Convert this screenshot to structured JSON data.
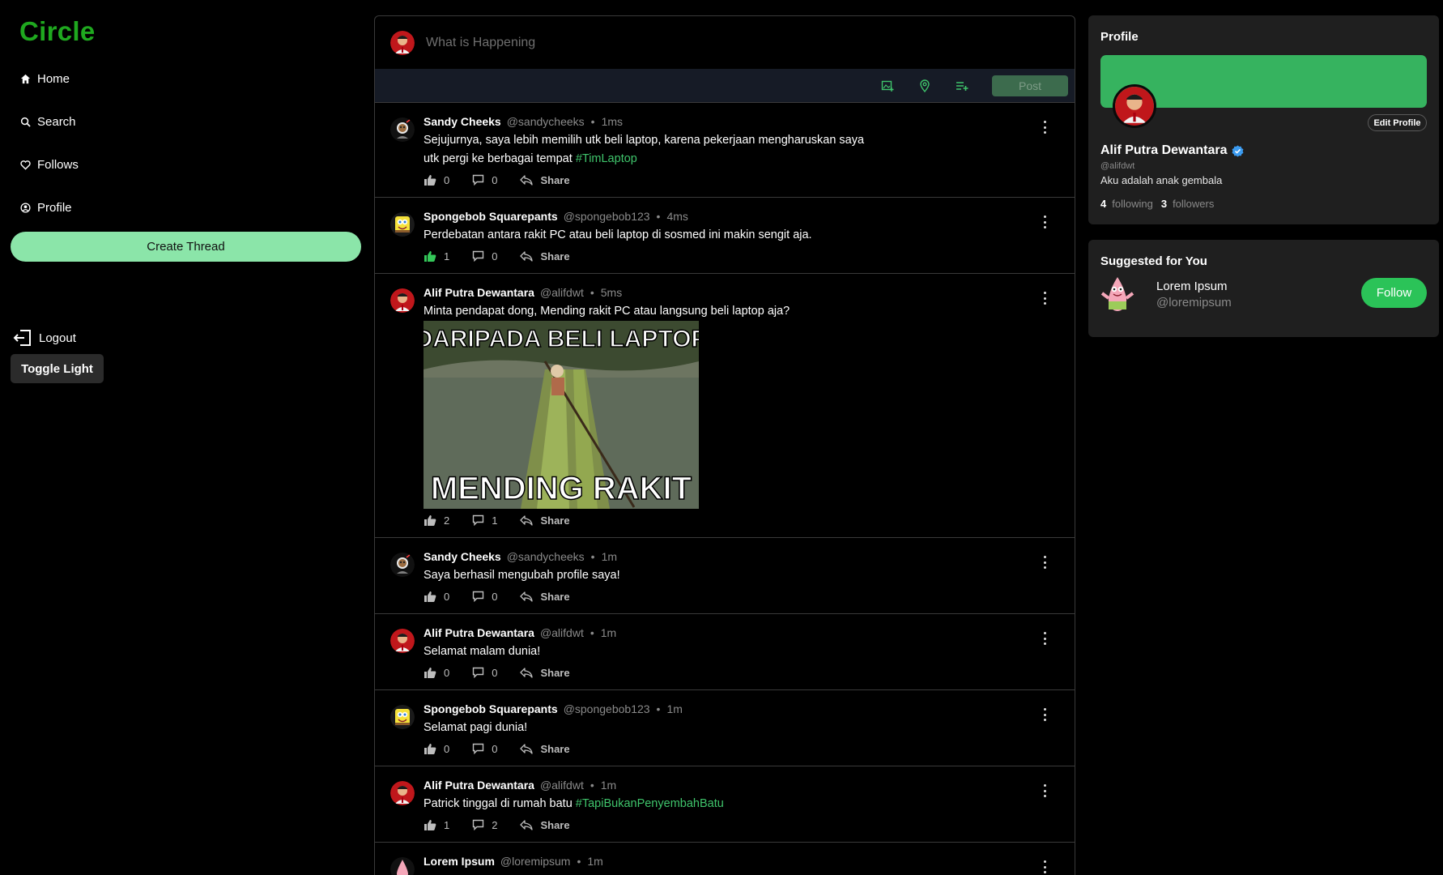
{
  "app": {
    "logo": "Circle"
  },
  "nav": {
    "home": "Home",
    "search": "Search",
    "follows": "Follows",
    "profile": "Profile",
    "create_thread": "Create Thread",
    "logout": "Logout",
    "toggle": "Toggle Light"
  },
  "composer": {
    "placeholder": "What is Happening",
    "post_label": "Post"
  },
  "threads": [
    {
      "name": "Sandy Cheeks",
      "handle": "@sandycheeks",
      "time": "1ms",
      "text": "Sejujurnya, saya lebih memilih utk beli laptop, karena pekerjaan mengharuskan saya utk pergi ke berbagai tempat ",
      "tag": "#TimLaptop",
      "likes": "0",
      "replies": "0",
      "share": "Share"
    },
    {
      "name": "Spongebob Squarepants",
      "handle": "@spongebob123",
      "time": "4ms",
      "text": "Perdebatan antara rakit PC atau beli laptop di sosmed ini makin sengit aja.",
      "likes": "1",
      "replies": "0",
      "share": "Share"
    },
    {
      "name": "Alif Putra Dewantara",
      "handle": "@alifdwt",
      "time": "5ms",
      "text": "Minta pendapat dong, Mending rakit PC atau langsung beli laptop aja?",
      "image_top": "DARIPADA BELI LAPTOP",
      "image_bottom": "MENDING RAKIT",
      "likes": "2",
      "replies": "1",
      "share": "Share"
    },
    {
      "name": "Sandy Cheeks",
      "handle": "@sandycheeks",
      "time": "1m",
      "text": "Saya berhasil mengubah profile saya!",
      "likes": "0",
      "replies": "0",
      "share": "Share"
    },
    {
      "name": "Alif Putra Dewantara",
      "handle": "@alifdwt",
      "time": "1m",
      "text": "Selamat malam dunia!",
      "likes": "0",
      "replies": "0",
      "share": "Share"
    },
    {
      "name": "Spongebob Squarepants",
      "handle": "@spongebob123",
      "time": "1m",
      "text": "Selamat pagi dunia!",
      "likes": "0",
      "replies": "0",
      "share": "Share"
    },
    {
      "name": "Alif Putra Dewantara",
      "handle": "@alifdwt",
      "time": "1m",
      "text": "Patrick tinggal di rumah batu ",
      "tag": "#TapiBukanPenyembahBatu",
      "likes": "1",
      "replies": "2",
      "share": "Share"
    },
    {
      "name": "Lorem Ipsum",
      "handle": "@loremipsum",
      "time": "1m",
      "text": "",
      "likes": "",
      "replies": "",
      "share": ""
    }
  ],
  "profile": {
    "title": "Profile",
    "edit": "Edit Profile",
    "name": "Alif Putra Dewantara",
    "handle": "@alifdwt",
    "bio": "Aku adalah anak gembala",
    "following_count": "4",
    "following_label": "following",
    "followers_count": "3",
    "followers_label": "followers"
  },
  "suggested": {
    "title": "Suggested for You",
    "name": "Lorem Ipsum",
    "handle": "@loremipsum",
    "follow": "Follow"
  },
  "colors": {
    "brand": "#1fa81f",
    "accent": "#2bc358",
    "banner": "#36b35f",
    "create_btn": "#8be5a9",
    "hashtag": "#3fc46b"
  }
}
